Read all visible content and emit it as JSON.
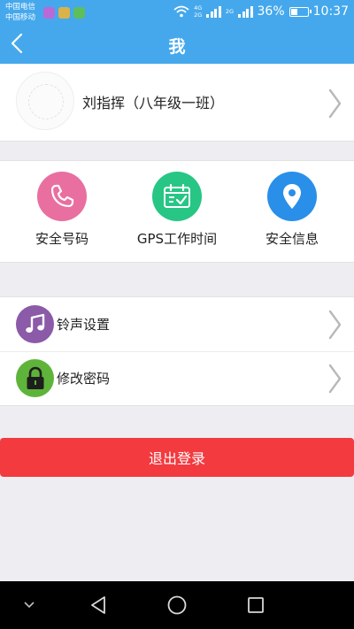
{
  "status_bar": {
    "carrier_1": "中国电信",
    "carrier_2": "中国移动",
    "net_top": "4G",
    "net_bottom": "2G",
    "net_right": "2G",
    "battery_text": "36%",
    "battery_level": 0.36,
    "time": "10:37",
    "app_colors": [
      "#b86ad8",
      "#d9b24a",
      "#5cbf5c"
    ]
  },
  "header": {
    "title": "我",
    "back_icon": "chevron-left-icon"
  },
  "profile": {
    "name": "刘指挥（八年级一班）",
    "avatar_icon": "avatar-placeholder-icon"
  },
  "shortcuts": [
    {
      "label": "安全号码",
      "icon": "phone-icon",
      "color": "#e96fa0"
    },
    {
      "label": "GPS工作时间",
      "icon": "calendar-check-icon",
      "color": "#27c684"
    },
    {
      "label": "安全信息",
      "icon": "location-pin-icon",
      "color": "#2a8fe8"
    }
  ],
  "settings": [
    {
      "label": "铃声设置",
      "icon": "music-note-icon",
      "color": "#8b5aa8"
    },
    {
      "label": "修改密码",
      "icon": "lock-icon",
      "color": "#5eb43a"
    }
  ],
  "logout": {
    "label": "退出登录",
    "color": "#f23a3f"
  },
  "nav_bar": {
    "icons": [
      "nav-collapse-icon",
      "nav-back-icon",
      "nav-home-icon",
      "nav-recents-icon"
    ]
  }
}
